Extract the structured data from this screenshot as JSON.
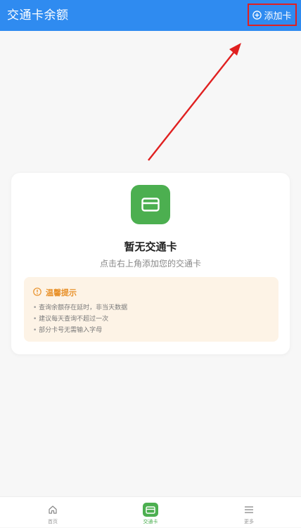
{
  "header": {
    "title": "交通卡余额",
    "add_button": {
      "label": "添加卡",
      "icon": "plus-circle-icon",
      "highlight_color": "#e02020"
    }
  },
  "empty_state": {
    "icon": "credit-card-icon",
    "title": "暂无交通卡",
    "subtitle": "点击右上角添加您的交通卡"
  },
  "tips": {
    "icon": "info-circle-icon",
    "title": "温馨提示",
    "items": [
      "查询余额存在延时，非当天数据",
      "建议每天查询不超过一次",
      "部分卡号无需输入字母"
    ]
  },
  "bottom_nav": {
    "items": [
      {
        "label": "首页",
        "icon": "home-icon",
        "active": false
      },
      {
        "label": "交通卡",
        "icon": "card-icon",
        "active": true
      },
      {
        "label": "更多",
        "icon": "menu-icon",
        "active": false
      }
    ]
  },
  "colors": {
    "header_bg": "#2f8bf0",
    "accent_green": "#4caf50",
    "tips_bg": "#fdf3e6",
    "tips_accent": "#e8912a",
    "annotation_red": "#e02020"
  }
}
